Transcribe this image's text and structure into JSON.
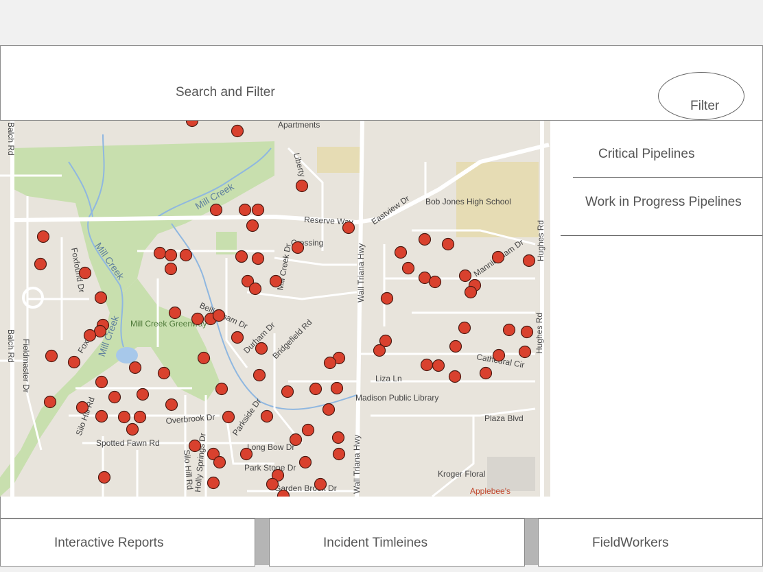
{
  "search_bar": {
    "label": "Search and Filter",
    "filter_button": "Filter"
  },
  "side_panel": {
    "items": [
      "Critical Pipelines",
      "Work in Progress Pipelines"
    ]
  },
  "bottom_tabs": [
    "Interactive Reports",
    "Incident Timleines",
    "FieldWorkers"
  ],
  "map": {
    "labels": {
      "apartments": "Apartments",
      "liberty": "Liberty",
      "mill_creek_1": "Mill Creek",
      "mill_creek_2": "Mill Creek",
      "mill_creek_3": "Mill Creek",
      "mill_creek_dr": "Mill Creek Dr",
      "reserve_way": "Reserve Way",
      "eastview_dr": "Eastview Dr",
      "bob_jones": "Bob Jones High School",
      "hughes_rd_1": "Hughes Rd",
      "hughes_rd_2": "Hughes Rd",
      "balch_rd_1": "Balch Rd",
      "balch_rd_2": "Balch Rd",
      "foxfound_dr": "Foxfound Dr",
      "crossing": "Crossing",
      "wall_triana_1": "Wall Triana Hwy",
      "wall_triana_2": "Wall Triana Hwy",
      "manningham_dr": "Manningham Dr",
      "mill_creek_greenway": "Mill Creek Greenway",
      "bellingham_dr": "Bellingham Dr",
      "durham_dr": "Durham Dr",
      "bridgefield_rd": "Bridgefield Rd",
      "fieldmaster_dr": "Fieldmaster Dr",
      "fox_dr": "Fox Dr",
      "cathedral_cir": "Cathedral Cir",
      "liza_ln": "Liza Ln",
      "madison_library": "Madison Public Library",
      "silo_hill_rd_1": "Silo Hill Rd",
      "silo_hill_rd_2": "Silo Hill Rd",
      "overbrook_dr": "Overbrook Dr",
      "parkside_dr": "Parkside Dr",
      "plaza_blvd": "Plaza Blvd",
      "spotted_fawn": "Spotted Fawn Rd",
      "holly_springs": "Holly Springs Dr",
      "long_bow": "Long Bow Dr",
      "park_stone": "Park Stone Dr",
      "garden_brook": "Garden Brook Dr",
      "kroger_floral": "Kroger Floral",
      "applebees": "Applebee's"
    },
    "marker_color": "#d9412e",
    "park_color": "#c8dfae",
    "school_color": "#e6dcb4"
  }
}
